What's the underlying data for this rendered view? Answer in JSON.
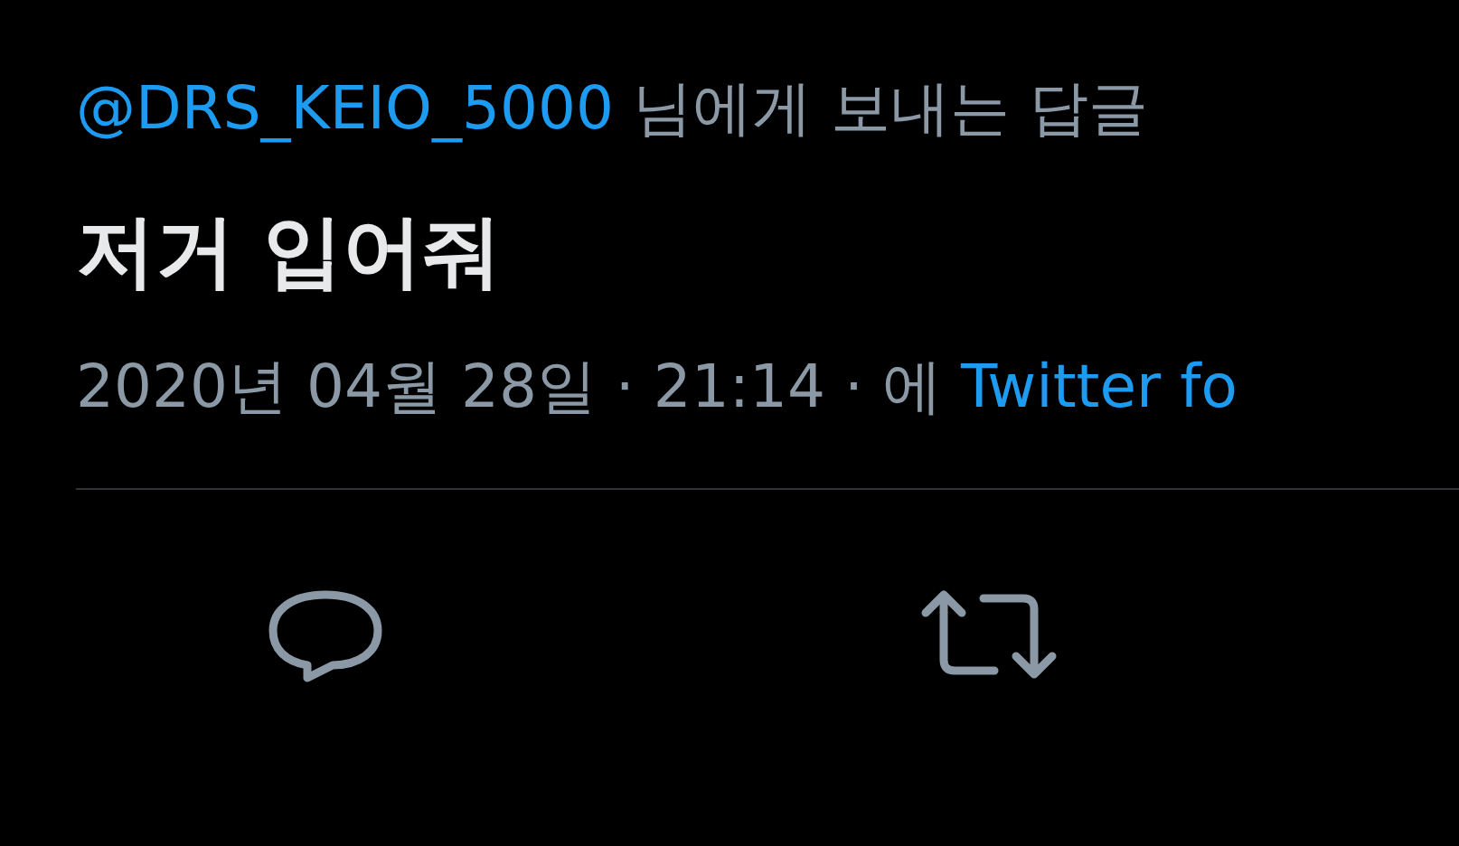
{
  "reply_context": {
    "handle": "@DRS_KEIO_5000",
    "text": "님에게 보내는 답글"
  },
  "tweet": {
    "text": "저거 입어줘"
  },
  "meta": {
    "timestamp": "2020년 04월 28일 · 21:14 · 에",
    "source": "Twitter fo"
  },
  "actions": [
    {
      "kind": "reply"
    },
    {
      "kind": "retweet"
    }
  ]
}
